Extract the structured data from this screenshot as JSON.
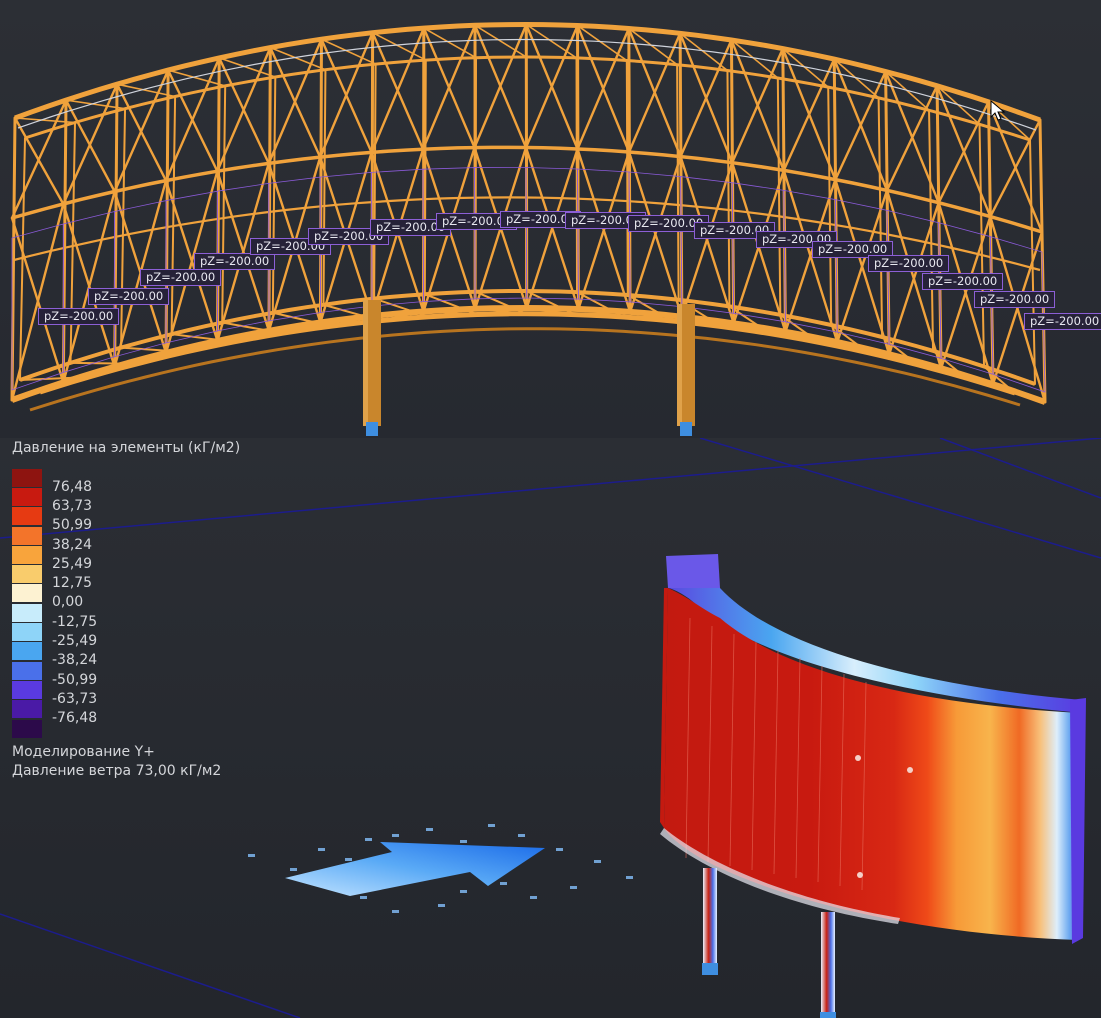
{
  "load_labels": [
    "pZ=-200.00",
    "pZ=-200.00",
    "pZ=-200.00",
    "pZ=-200.00",
    "pZ=-200.00",
    "pZ=-200.00",
    "pZ=-200.00",
    "pZ=-200.00",
    "pZ=-200.00",
    "pZ=-200.00",
    "pZ=-200.00",
    "pZ=-200.00",
    "pZ=-200.00",
    "pZ=-200.00",
    "pZ=-200.00",
    "pZ=-200.00",
    "pZ=-200.00",
    "pZ=-200.00"
  ],
  "legend": {
    "title": "Давление на элементы (кГ/м2)",
    "values": [
      "76,48",
      "63,73",
      "50,99",
      "38,24",
      "25,49",
      "12,75",
      "0,00",
      "-12,75",
      "-25,49",
      "-38,24",
      "-50,99",
      "-63,73",
      "-76,48"
    ],
    "colors": [
      "#8e1410",
      "#c81a10",
      "#e63a12",
      "#f3742a",
      "#f8a43c",
      "#f9cc6c",
      "#fdf2d2",
      "#c8ecfb",
      "#8ed4f8",
      "#4aa6f0",
      "#4a70ea",
      "#5a3ae0",
      "#4a1aa6",
      "#2c0a4a"
    ]
  },
  "simulation": {
    "mode": "Моделирование Y+",
    "wind_pressure": "Давление ветра 73,00 кГ/м2"
  },
  "colors": {
    "truss": "#f0a23c",
    "truss_shadow": "#b8741f",
    "column": "#c9862c",
    "support": "#3e8ee0",
    "grid_line": "#1c1c8c"
  }
}
